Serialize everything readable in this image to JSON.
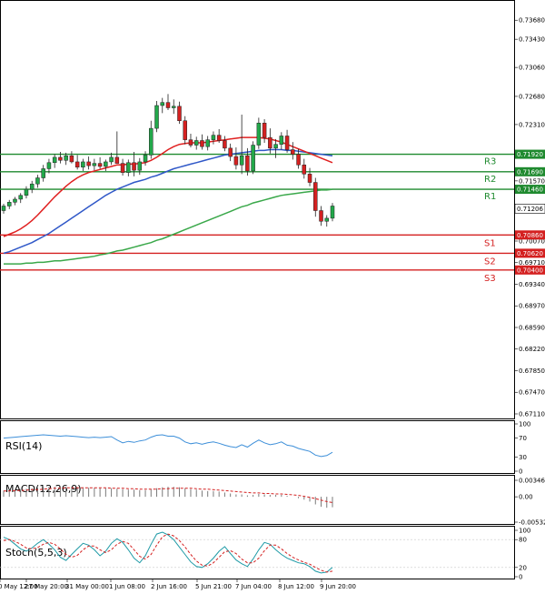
{
  "chart_data": {
    "type": "candlestick",
    "symbol": "",
    "colors": {
      "bull": "#22a84a",
      "bear": "#d42020",
      "wick": "#222222",
      "ma_fast": "#e02020",
      "ma_mid": "#3058c8",
      "ma_slow": "#3aa84a",
      "resistance": "#1f8a2f",
      "support": "#d42020",
      "rsi": "#3d8fd9",
      "macd_hist": "#7a7a7a",
      "macd_signal": "#d42020",
      "stoch_k": "#1e9aa6",
      "stoch_d": "#d42020",
      "grid": "#d8d8d8",
      "frame": "#000000"
    },
    "price_axis": {
      "ylim": [
        0.7078,
        0.7385
      ],
      "ticks": [
        "0.73680",
        "0.73430",
        "0.73060",
        "0.72680",
        "0.72310",
        "0.71570",
        "0.71206",
        "0.70070",
        "0.69710",
        "0.69340",
        "0.68970",
        "0.68590",
        "0.68220",
        "0.67850",
        "0.67470",
        "0.67110"
      ],
      "tick_values": [
        0.7368,
        0.7343,
        0.7306,
        0.7268,
        0.7231,
        0.7157,
        0.71206,
        0.7007,
        0.6971,
        0.6934,
        0.6897,
        0.6859,
        0.6822,
        0.6785,
        0.6747,
        0.6711
      ],
      "current_price": "0.71206",
      "current_price_value": 0.71206
    },
    "levels": [
      {
        "name": "R3",
        "value": 0.7192,
        "label": "0.71920",
        "kind": "resistance"
      },
      {
        "name": "R2",
        "value": 0.7169,
        "label": "0.71690",
        "kind": "resistance"
      },
      {
        "name": "R1",
        "value": 0.7146,
        "label": "0.71460",
        "kind": "resistance"
      },
      {
        "name": "S1",
        "value": 0.7086,
        "label": "0.70860",
        "kind": "support"
      },
      {
        "name": "S2",
        "value": 0.7062,
        "label": "0.70620",
        "kind": "support"
      },
      {
        "name": "S3",
        "value": 0.704,
        "label": "0.70400",
        "kind": "support"
      }
    ],
    "x_labels": [
      "0 May 12:00",
      "27 May 20:00",
      "31 May 00:00",
      "1 Jun 08:00",
      "2 Jun 16:00",
      "5 Jun 21:00",
      "7 Jun 04:00",
      "8 Jun 12:00",
      "9 Jun 20:00"
    ],
    "candles": [
      {
        "o": 0.7118,
        "h": 0.7127,
        "l": 0.7114,
        "c": 0.7124
      },
      {
        "o": 0.7124,
        "h": 0.7132,
        "l": 0.712,
        "c": 0.7129
      },
      {
        "o": 0.7129,
        "h": 0.7136,
        "l": 0.7125,
        "c": 0.7133
      },
      {
        "o": 0.7133,
        "h": 0.7141,
        "l": 0.7128,
        "c": 0.7138
      },
      {
        "o": 0.7138,
        "h": 0.715,
        "l": 0.7134,
        "c": 0.7146
      },
      {
        "o": 0.7146,
        "h": 0.7157,
        "l": 0.7141,
        "c": 0.7153
      },
      {
        "o": 0.7153,
        "h": 0.7165,
        "l": 0.7148,
        "c": 0.7161
      },
      {
        "o": 0.7161,
        "h": 0.7178,
        "l": 0.7156,
        "c": 0.7173
      },
      {
        "o": 0.7173,
        "h": 0.7186,
        "l": 0.7167,
        "c": 0.7181
      },
      {
        "o": 0.7181,
        "h": 0.7192,
        "l": 0.7174,
        "c": 0.7188
      },
      {
        "o": 0.7188,
        "h": 0.7195,
        "l": 0.718,
        "c": 0.7184
      },
      {
        "o": 0.7184,
        "h": 0.7194,
        "l": 0.7178,
        "c": 0.719
      },
      {
        "o": 0.719,
        "h": 0.7196,
        "l": 0.718,
        "c": 0.7182
      },
      {
        "o": 0.7182,
        "h": 0.7191,
        "l": 0.7172,
        "c": 0.7175
      },
      {
        "o": 0.7175,
        "h": 0.7186,
        "l": 0.717,
        "c": 0.7182
      },
      {
        "o": 0.7182,
        "h": 0.7189,
        "l": 0.7172,
        "c": 0.7177
      },
      {
        "o": 0.7177,
        "h": 0.7186,
        "l": 0.7171,
        "c": 0.718
      },
      {
        "o": 0.718,
        "h": 0.7188,
        "l": 0.7173,
        "c": 0.7176
      },
      {
        "o": 0.7176,
        "h": 0.7185,
        "l": 0.717,
        "c": 0.7182
      },
      {
        "o": 0.7182,
        "h": 0.7194,
        "l": 0.7178,
        "c": 0.7188
      },
      {
        "o": 0.7188,
        "h": 0.7222,
        "l": 0.718,
        "c": 0.718
      },
      {
        "o": 0.718,
        "h": 0.7186,
        "l": 0.7164,
        "c": 0.7168
      },
      {
        "o": 0.7168,
        "h": 0.7185,
        "l": 0.7163,
        "c": 0.7181
      },
      {
        "o": 0.7181,
        "h": 0.7195,
        "l": 0.7163,
        "c": 0.7171
      },
      {
        "o": 0.7171,
        "h": 0.7187,
        "l": 0.7165,
        "c": 0.7182
      },
      {
        "o": 0.7182,
        "h": 0.7196,
        "l": 0.7177,
        "c": 0.7191
      },
      {
        "o": 0.7191,
        "h": 0.7236,
        "l": 0.7186,
        "c": 0.7226
      },
      {
        "o": 0.7226,
        "h": 0.7262,
        "l": 0.7221,
        "c": 0.7256
      },
      {
        "o": 0.7256,
        "h": 0.7266,
        "l": 0.7246,
        "c": 0.726
      },
      {
        "o": 0.726,
        "h": 0.7271,
        "l": 0.725,
        "c": 0.7253
      },
      {
        "o": 0.7253,
        "h": 0.7264,
        "l": 0.7245,
        "c": 0.7255
      },
      {
        "o": 0.7255,
        "h": 0.7261,
        "l": 0.7232,
        "c": 0.7236
      },
      {
        "o": 0.7236,
        "h": 0.7242,
        "l": 0.7205,
        "c": 0.7211
      },
      {
        "o": 0.7211,
        "h": 0.7219,
        "l": 0.7201,
        "c": 0.7204
      },
      {
        "o": 0.7204,
        "h": 0.7215,
        "l": 0.7198,
        "c": 0.721
      },
      {
        "o": 0.721,
        "h": 0.7218,
        "l": 0.7198,
        "c": 0.7202
      },
      {
        "o": 0.7202,
        "h": 0.7216,
        "l": 0.7197,
        "c": 0.7211
      },
      {
        "o": 0.7211,
        "h": 0.7222,
        "l": 0.7205,
        "c": 0.7217
      },
      {
        "o": 0.7217,
        "h": 0.7225,
        "l": 0.7207,
        "c": 0.721
      },
      {
        "o": 0.721,
        "h": 0.7216,
        "l": 0.7196,
        "c": 0.72
      },
      {
        "o": 0.72,
        "h": 0.7206,
        "l": 0.7183,
        "c": 0.7189
      },
      {
        "o": 0.7189,
        "h": 0.7201,
        "l": 0.7172,
        "c": 0.7178
      },
      {
        "o": 0.7178,
        "h": 0.7244,
        "l": 0.7166,
        "c": 0.719
      },
      {
        "o": 0.719,
        "h": 0.72,
        "l": 0.7164,
        "c": 0.717
      },
      {
        "o": 0.717,
        "h": 0.7209,
        "l": 0.7166,
        "c": 0.7204
      },
      {
        "o": 0.7204,
        "h": 0.724,
        "l": 0.7199,
        "c": 0.7233
      },
      {
        "o": 0.7233,
        "h": 0.7238,
        "l": 0.7207,
        "c": 0.7214
      },
      {
        "o": 0.7214,
        "h": 0.7226,
        "l": 0.7193,
        "c": 0.72
      },
      {
        "o": 0.72,
        "h": 0.7212,
        "l": 0.7187,
        "c": 0.7205
      },
      {
        "o": 0.7205,
        "h": 0.7221,
        "l": 0.7198,
        "c": 0.7216
      },
      {
        "o": 0.7216,
        "h": 0.7224,
        "l": 0.7194,
        "c": 0.7198
      },
      {
        "o": 0.7198,
        "h": 0.7208,
        "l": 0.7185,
        "c": 0.7192
      },
      {
        "o": 0.7192,
        "h": 0.7199,
        "l": 0.7173,
        "c": 0.7178
      },
      {
        "o": 0.7178,
        "h": 0.7186,
        "l": 0.716,
        "c": 0.7166
      },
      {
        "o": 0.7166,
        "h": 0.7174,
        "l": 0.715,
        "c": 0.7155
      },
      {
        "o": 0.7155,
        "h": 0.7161,
        "l": 0.711,
        "c": 0.7118
      },
      {
        "o": 0.7118,
        "h": 0.7124,
        "l": 0.7098,
        "c": 0.7104
      },
      {
        "o": 0.7104,
        "h": 0.7112,
        "l": 0.7097,
        "c": 0.7108
      },
      {
        "o": 0.7108,
        "h": 0.7128,
        "l": 0.7104,
        "c": 0.7124
      }
    ],
    "ma_fast": [
      0.7084,
      0.7087,
      0.709,
      0.7094,
      0.7099,
      0.7105,
      0.7112,
      0.712,
      0.7128,
      0.7136,
      0.7143,
      0.715,
      0.7156,
      0.7161,
      0.7165,
      0.7168,
      0.717,
      0.7172,
      0.7174,
      0.7176,
      0.7178,
      0.7178,
      0.7179,
      0.7179,
      0.718,
      0.7181,
      0.7184,
      0.7188,
      0.7193,
      0.7198,
      0.7202,
      0.7205,
      0.7206,
      0.7207,
      0.7207,
      0.7207,
      0.7208,
      0.7209,
      0.721,
      0.7211,
      0.7212,
      0.7213,
      0.7214,
      0.7214,
      0.7214,
      0.7214,
      0.7213,
      0.7212,
      0.721,
      0.7208,
      0.7205,
      0.7202,
      0.7199,
      0.7196,
      0.7193,
      0.719,
      0.7187,
      0.7184,
      0.7181
    ],
    "ma_mid": [
      0.7062,
      0.7064,
      0.7067,
      0.707,
      0.7073,
      0.7076,
      0.708,
      0.7084,
      0.7088,
      0.7093,
      0.7098,
      0.7103,
      0.7108,
      0.7113,
      0.7118,
      0.7123,
      0.7128,
      0.7133,
      0.7138,
      0.7142,
      0.7146,
      0.7149,
      0.7152,
      0.7155,
      0.7157,
      0.7159,
      0.7162,
      0.7164,
      0.7167,
      0.717,
      0.7173,
      0.7175,
      0.7177,
      0.7179,
      0.7181,
      0.7183,
      0.7185,
      0.7187,
      0.7189,
      0.7191,
      0.7192,
      0.7193,
      0.7194,
      0.7195,
      0.7196,
      0.7197,
      0.7197,
      0.7198,
      0.7198,
      0.7198,
      0.7197,
      0.7197,
      0.7196,
      0.7195,
      0.7194,
      0.7193,
      0.7192,
      0.7191,
      0.719
    ],
    "ma_slow": [
      0.7048,
      0.7048,
      0.7048,
      0.7048,
      0.7049,
      0.7049,
      0.705,
      0.705,
      0.7051,
      0.7052,
      0.7052,
      0.7053,
      0.7054,
      0.7055,
      0.7056,
      0.7057,
      0.7058,
      0.706,
      0.7061,
      0.7063,
      0.7065,
      0.7066,
      0.7068,
      0.707,
      0.7072,
      0.7074,
      0.7076,
      0.7079,
      0.7081,
      0.7084,
      0.7087,
      0.709,
      0.7093,
      0.7096,
      0.7099,
      0.7102,
      0.7105,
      0.7108,
      0.7111,
      0.7114,
      0.7117,
      0.712,
      0.7123,
      0.7125,
      0.7128,
      0.713,
      0.7132,
      0.7134,
      0.7136,
      0.7138,
      0.7139,
      0.714,
      0.7141,
      0.7142,
      0.7143,
      0.7144,
      0.7145,
      0.7145,
      0.7146
    ],
    "indicators": {
      "rsi": {
        "title": "RSI(14)",
        "ylim": [
          0,
          100
        ],
        "ticks": [
          "100",
          "70",
          "30",
          "0"
        ],
        "tick_values": [
          100,
          70,
          30,
          0
        ],
        "values": [
          70,
          71,
          72,
          73,
          74,
          75,
          76,
          77,
          76,
          75,
          74,
          75,
          74,
          73,
          72,
          71,
          72,
          71,
          72,
          73,
          66,
          60,
          63,
          61,
          64,
          66,
          72,
          76,
          77,
          74,
          74,
          70,
          62,
          58,
          60,
          57,
          60,
          62,
          59,
          55,
          52,
          50,
          56,
          51,
          59,
          66,
          60,
          56,
          58,
          62,
          55,
          53,
          48,
          45,
          42,
          34,
          31,
          33,
          40
        ]
      },
      "macd": {
        "title": "MACD(12,26,9)",
        "ticks": [
          "0.003462",
          "0.00",
          "-0.00532"
        ],
        "tick_values": [
          0.003462,
          0,
          -0.00532
        ],
        "ylim": [
          -0.00532,
          0.003462
        ],
        "hist": [
          0.0013,
          0.0014,
          0.0015,
          0.0016,
          0.0017,
          0.0018,
          0.0019,
          0.002,
          0.0021,
          0.0021,
          0.0021,
          0.0021,
          0.0021,
          0.002,
          0.002,
          0.0019,
          0.0019,
          0.0018,
          0.0018,
          0.0018,
          0.0017,
          0.0016,
          0.0015,
          0.0015,
          0.0014,
          0.0014,
          0.0016,
          0.0018,
          0.002,
          0.0021,
          0.0021,
          0.002,
          0.0018,
          0.0016,
          0.0015,
          0.0013,
          0.0012,
          0.0012,
          0.0011,
          0.0009,
          0.0007,
          0.0005,
          0.0005,
          0.0003,
          0.0004,
          0.0006,
          0.0005,
          0.0004,
          0.0004,
          0.0004,
          0.0002,
          0.0,
          -0.0003,
          -0.0006,
          -0.001,
          -0.0016,
          -0.0021,
          -0.0023,
          -0.0022
        ],
        "signal": [
          0.0012,
          0.0012,
          0.0013,
          0.0013,
          0.0014,
          0.0015,
          0.0015,
          0.0016,
          0.0017,
          0.0018,
          0.0018,
          0.0019,
          0.0019,
          0.0019,
          0.0019,
          0.0019,
          0.0019,
          0.0019,
          0.0019,
          0.0018,
          0.0018,
          0.0018,
          0.0017,
          0.0017,
          0.0016,
          0.0016,
          0.0016,
          0.0016,
          0.0017,
          0.0017,
          0.0018,
          0.0018,
          0.0018,
          0.0018,
          0.0017,
          0.0016,
          0.0016,
          0.0015,
          0.0014,
          0.0013,
          0.0012,
          0.0011,
          0.001,
          0.0009,
          0.0008,
          0.0008,
          0.0007,
          0.0007,
          0.0006,
          0.0006,
          0.0005,
          0.0004,
          0.0003,
          0.0001,
          -0.0001,
          -0.0004,
          -0.0007,
          -0.001,
          -0.0012
        ]
      },
      "stoch": {
        "title": "Stoch(5,5,3)",
        "ylim": [
          0,
          100
        ],
        "ticks": [
          "100",
          "80",
          "20",
          "0"
        ],
        "tick_values": [
          100,
          80,
          20,
          0
        ],
        "k": [
          85,
          80,
          70,
          60,
          55,
          62,
          72,
          80,
          70,
          58,
          42,
          35,
          48,
          60,
          72,
          68,
          58,
          45,
          55,
          72,
          82,
          74,
          58,
          40,
          30,
          45,
          70,
          92,
          96,
          90,
          80,
          64,
          48,
          32,
          22,
          20,
          28,
          40,
          55,
          65,
          50,
          36,
          28,
          22,
          38,
          58,
          74,
          70,
          58,
          48,
          40,
          35,
          30,
          28,
          22,
          12,
          8,
          10,
          20
        ],
        "d": [
          78,
          80,
          76,
          70,
          62,
          60,
          63,
          70,
          74,
          70,
          60,
          48,
          42,
          46,
          58,
          66,
          66,
          58,
          52,
          58,
          70,
          76,
          72,
          58,
          44,
          38,
          48,
          68,
          86,
          92,
          88,
          78,
          64,
          48,
          34,
          25,
          23,
          30,
          42,
          54,
          56,
          50,
          38,
          30,
          30,
          40,
          56,
          68,
          68,
          60,
          50,
          42,
          36,
          31,
          27,
          20,
          14,
          10,
          12
        ]
      }
    }
  }
}
